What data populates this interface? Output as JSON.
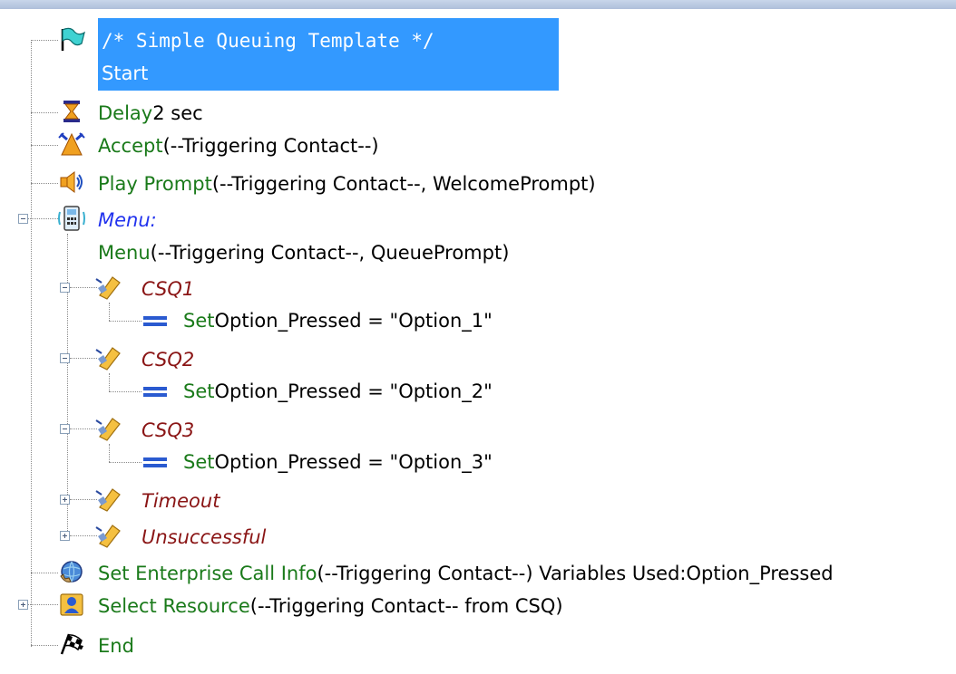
{
  "tree": {
    "start": {
      "comment": "/* Simple Queuing Template */",
      "label": "Start"
    },
    "delay": {
      "keyword": "Delay",
      "args": " 2 sec"
    },
    "accept": {
      "keyword": "Accept",
      "args": " (--Triggering Contact--)"
    },
    "play_prompt": {
      "keyword": "Play Prompt",
      "args": " (--Triggering Contact--, WelcomePrompt)"
    },
    "menu": {
      "label": "Menu:",
      "detail_keyword": "Menu",
      "detail_args": " (--Triggering Contact--, QueuePrompt)",
      "branches": [
        {
          "label": "CSQ1",
          "child_keyword": "Set",
          "child_args": " Option_Pressed = \"Option_1\""
        },
        {
          "label": "CSQ2",
          "child_keyword": "Set",
          "child_args": " Option_Pressed = \"Option_2\""
        },
        {
          "label": "CSQ3",
          "child_keyword": "Set",
          "child_args": " Option_Pressed = \"Option_3\""
        },
        {
          "label": "Timeout"
        },
        {
          "label": "Unsuccessful"
        }
      ]
    },
    "set_enterprise": {
      "keyword": "Set Enterprise Call Info",
      "args": " (--Triggering Contact--) Variables Used:Option_Pressed"
    },
    "select_resource": {
      "keyword": "Select Resource",
      "args": " (--Triggering Contact-- from CSQ)"
    },
    "end": {
      "label": "End"
    }
  },
  "colors": {
    "selection": "#3399ff",
    "keyword": "#1a7a1a",
    "menu_label": "#2233ee",
    "branch_label": "#8a1515"
  },
  "icons": {
    "start": "flag-icon",
    "delay": "hourglass-icon",
    "accept": "accept-icon",
    "play_prompt": "speaker-icon",
    "menu": "menu-phone-icon",
    "branch": "tag-icon",
    "set": "equals-icon",
    "set_enterprise": "globe-phone-icon",
    "select_resource": "agent-icon",
    "end": "checkered-flag-icon"
  }
}
